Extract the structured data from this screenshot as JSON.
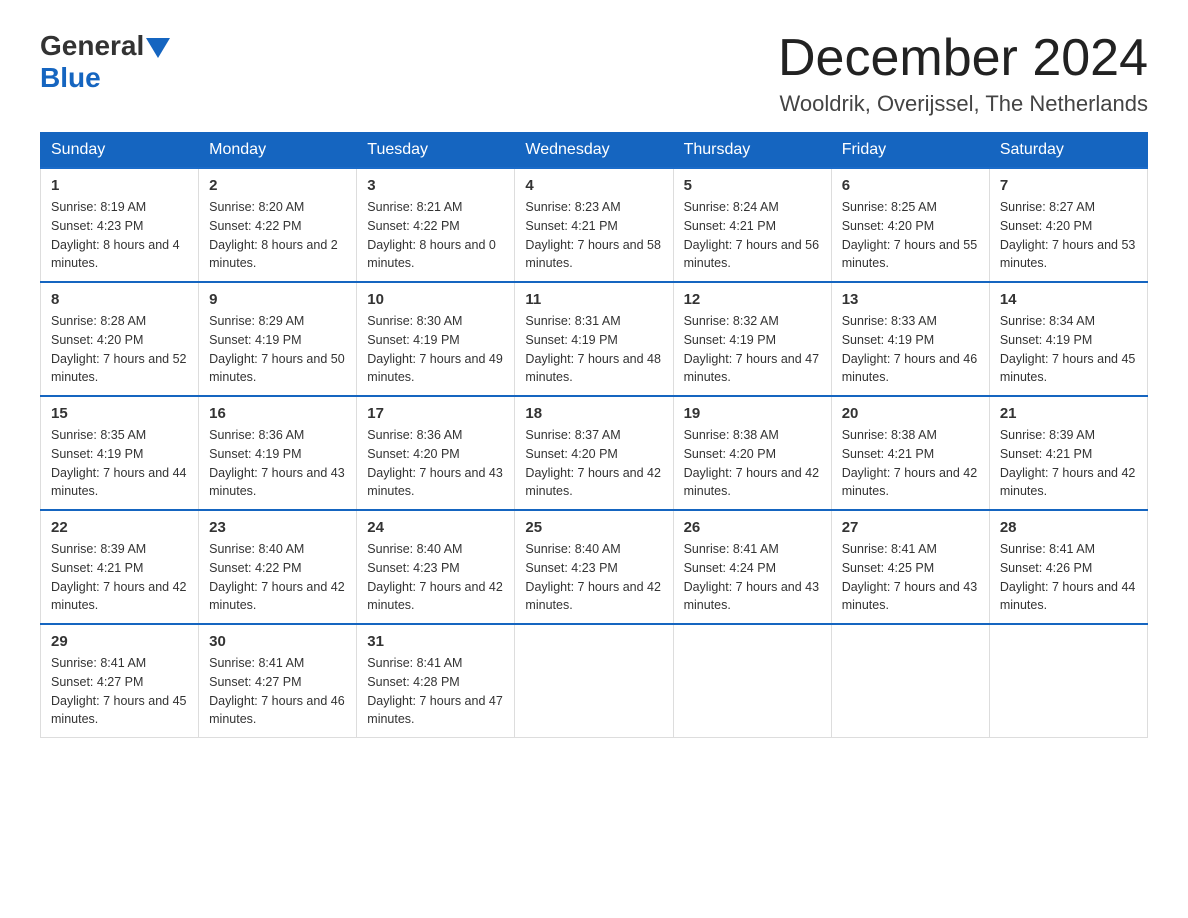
{
  "header": {
    "logo_general": "General",
    "logo_blue": "Blue",
    "month_title": "December 2024",
    "location": "Wooldrik, Overijssel, The Netherlands"
  },
  "days_of_week": [
    "Sunday",
    "Monday",
    "Tuesday",
    "Wednesday",
    "Thursday",
    "Friday",
    "Saturday"
  ],
  "weeks": [
    [
      {
        "day": "1",
        "sunrise": "8:19 AM",
        "sunset": "4:23 PM",
        "daylight": "8 hours and 4 minutes."
      },
      {
        "day": "2",
        "sunrise": "8:20 AM",
        "sunset": "4:22 PM",
        "daylight": "8 hours and 2 minutes."
      },
      {
        "day": "3",
        "sunrise": "8:21 AM",
        "sunset": "4:22 PM",
        "daylight": "8 hours and 0 minutes."
      },
      {
        "day": "4",
        "sunrise": "8:23 AM",
        "sunset": "4:21 PM",
        "daylight": "7 hours and 58 minutes."
      },
      {
        "day": "5",
        "sunrise": "8:24 AM",
        "sunset": "4:21 PM",
        "daylight": "7 hours and 56 minutes."
      },
      {
        "day": "6",
        "sunrise": "8:25 AM",
        "sunset": "4:20 PM",
        "daylight": "7 hours and 55 minutes."
      },
      {
        "day": "7",
        "sunrise": "8:27 AM",
        "sunset": "4:20 PM",
        "daylight": "7 hours and 53 minutes."
      }
    ],
    [
      {
        "day": "8",
        "sunrise": "8:28 AM",
        "sunset": "4:20 PM",
        "daylight": "7 hours and 52 minutes."
      },
      {
        "day": "9",
        "sunrise": "8:29 AM",
        "sunset": "4:19 PM",
        "daylight": "7 hours and 50 minutes."
      },
      {
        "day": "10",
        "sunrise": "8:30 AM",
        "sunset": "4:19 PM",
        "daylight": "7 hours and 49 minutes."
      },
      {
        "day": "11",
        "sunrise": "8:31 AM",
        "sunset": "4:19 PM",
        "daylight": "7 hours and 48 minutes."
      },
      {
        "day": "12",
        "sunrise": "8:32 AM",
        "sunset": "4:19 PM",
        "daylight": "7 hours and 47 minutes."
      },
      {
        "day": "13",
        "sunrise": "8:33 AM",
        "sunset": "4:19 PM",
        "daylight": "7 hours and 46 minutes."
      },
      {
        "day": "14",
        "sunrise": "8:34 AM",
        "sunset": "4:19 PM",
        "daylight": "7 hours and 45 minutes."
      }
    ],
    [
      {
        "day": "15",
        "sunrise": "8:35 AM",
        "sunset": "4:19 PM",
        "daylight": "7 hours and 44 minutes."
      },
      {
        "day": "16",
        "sunrise": "8:36 AM",
        "sunset": "4:19 PM",
        "daylight": "7 hours and 43 minutes."
      },
      {
        "day": "17",
        "sunrise": "8:36 AM",
        "sunset": "4:20 PM",
        "daylight": "7 hours and 43 minutes."
      },
      {
        "day": "18",
        "sunrise": "8:37 AM",
        "sunset": "4:20 PM",
        "daylight": "7 hours and 42 minutes."
      },
      {
        "day": "19",
        "sunrise": "8:38 AM",
        "sunset": "4:20 PM",
        "daylight": "7 hours and 42 minutes."
      },
      {
        "day": "20",
        "sunrise": "8:38 AM",
        "sunset": "4:21 PM",
        "daylight": "7 hours and 42 minutes."
      },
      {
        "day": "21",
        "sunrise": "8:39 AM",
        "sunset": "4:21 PM",
        "daylight": "7 hours and 42 minutes."
      }
    ],
    [
      {
        "day": "22",
        "sunrise": "8:39 AM",
        "sunset": "4:21 PM",
        "daylight": "7 hours and 42 minutes."
      },
      {
        "day": "23",
        "sunrise": "8:40 AM",
        "sunset": "4:22 PM",
        "daylight": "7 hours and 42 minutes."
      },
      {
        "day": "24",
        "sunrise": "8:40 AM",
        "sunset": "4:23 PM",
        "daylight": "7 hours and 42 minutes."
      },
      {
        "day": "25",
        "sunrise": "8:40 AM",
        "sunset": "4:23 PM",
        "daylight": "7 hours and 42 minutes."
      },
      {
        "day": "26",
        "sunrise": "8:41 AM",
        "sunset": "4:24 PM",
        "daylight": "7 hours and 43 minutes."
      },
      {
        "day": "27",
        "sunrise": "8:41 AM",
        "sunset": "4:25 PM",
        "daylight": "7 hours and 43 minutes."
      },
      {
        "day": "28",
        "sunrise": "8:41 AM",
        "sunset": "4:26 PM",
        "daylight": "7 hours and 44 minutes."
      }
    ],
    [
      {
        "day": "29",
        "sunrise": "8:41 AM",
        "sunset": "4:27 PM",
        "daylight": "7 hours and 45 minutes."
      },
      {
        "day": "30",
        "sunrise": "8:41 AM",
        "sunset": "4:27 PM",
        "daylight": "7 hours and 46 minutes."
      },
      {
        "day": "31",
        "sunrise": "8:41 AM",
        "sunset": "4:28 PM",
        "daylight": "7 hours and 47 minutes."
      },
      null,
      null,
      null,
      null
    ]
  ],
  "labels": {
    "sunrise": "Sunrise:",
    "sunset": "Sunset:",
    "daylight": "Daylight:"
  }
}
